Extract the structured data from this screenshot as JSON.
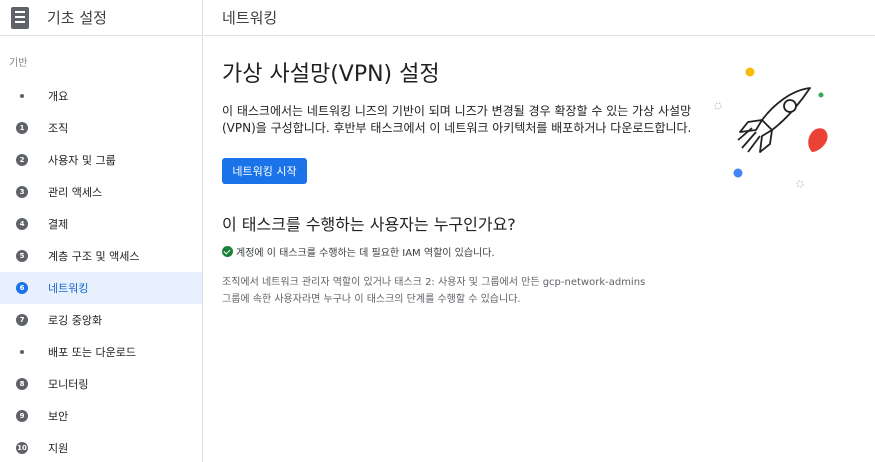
{
  "sidebar": {
    "app_title": "기초 설정",
    "section_label": "기반",
    "items": [
      {
        "marker": "",
        "label": "개요"
      },
      {
        "marker": "1",
        "label": "조직"
      },
      {
        "marker": "2",
        "label": "사용자 및 그룹"
      },
      {
        "marker": "3",
        "label": "관리 액세스"
      },
      {
        "marker": "4",
        "label": "결제"
      },
      {
        "marker": "5",
        "label": "계층 구조 및 액세스"
      },
      {
        "marker": "6",
        "label": "네트워킹"
      },
      {
        "marker": "7",
        "label": "로깅 중앙화"
      },
      {
        "marker": "",
        "label": "배포 또는 다운로드"
      },
      {
        "marker": "8",
        "label": "모니터링"
      },
      {
        "marker": "9",
        "label": "보안"
      },
      {
        "marker": "10",
        "label": "지원"
      }
    ],
    "active_index": 6
  },
  "topbar": {
    "title": "네트워킹"
  },
  "main": {
    "title": "가상 사설망(VPN) 설정",
    "intro": "이 태스크에서는 네트워킹 니즈의 기반이 되며 니즈가 변경될 경우 확장할 수 있는 가상 사설망(VPN)을 구성합니다. 후반부 태스크에서 이 네트워크 아키텍처를 배포하거나 다운로드합니다.",
    "start_button": "네트워킹 시작",
    "who_title": "이 태스크를 수행하는 사용자는 누구인가요?",
    "requirement": "계정에 이 태스크를 수행하는 데 필요한 IAM 역할이 있습니다.",
    "note": "조직에서 네트워크 관리자 역할이 있거나 태스크 2: 사용자 및 그룹에서 만든 gcp-network-admins 그룹에 속한 사용자라면 누구나 이 태스크의 단계를 수행할 수 있습니다."
  },
  "icons": {
    "app": "checklist-icon",
    "check": "check-circle-icon",
    "illustration": "rocket-illustration"
  },
  "colors": {
    "accent": "#1a73e8",
    "active_bg": "#e8f0fe",
    "success": "#188038"
  }
}
